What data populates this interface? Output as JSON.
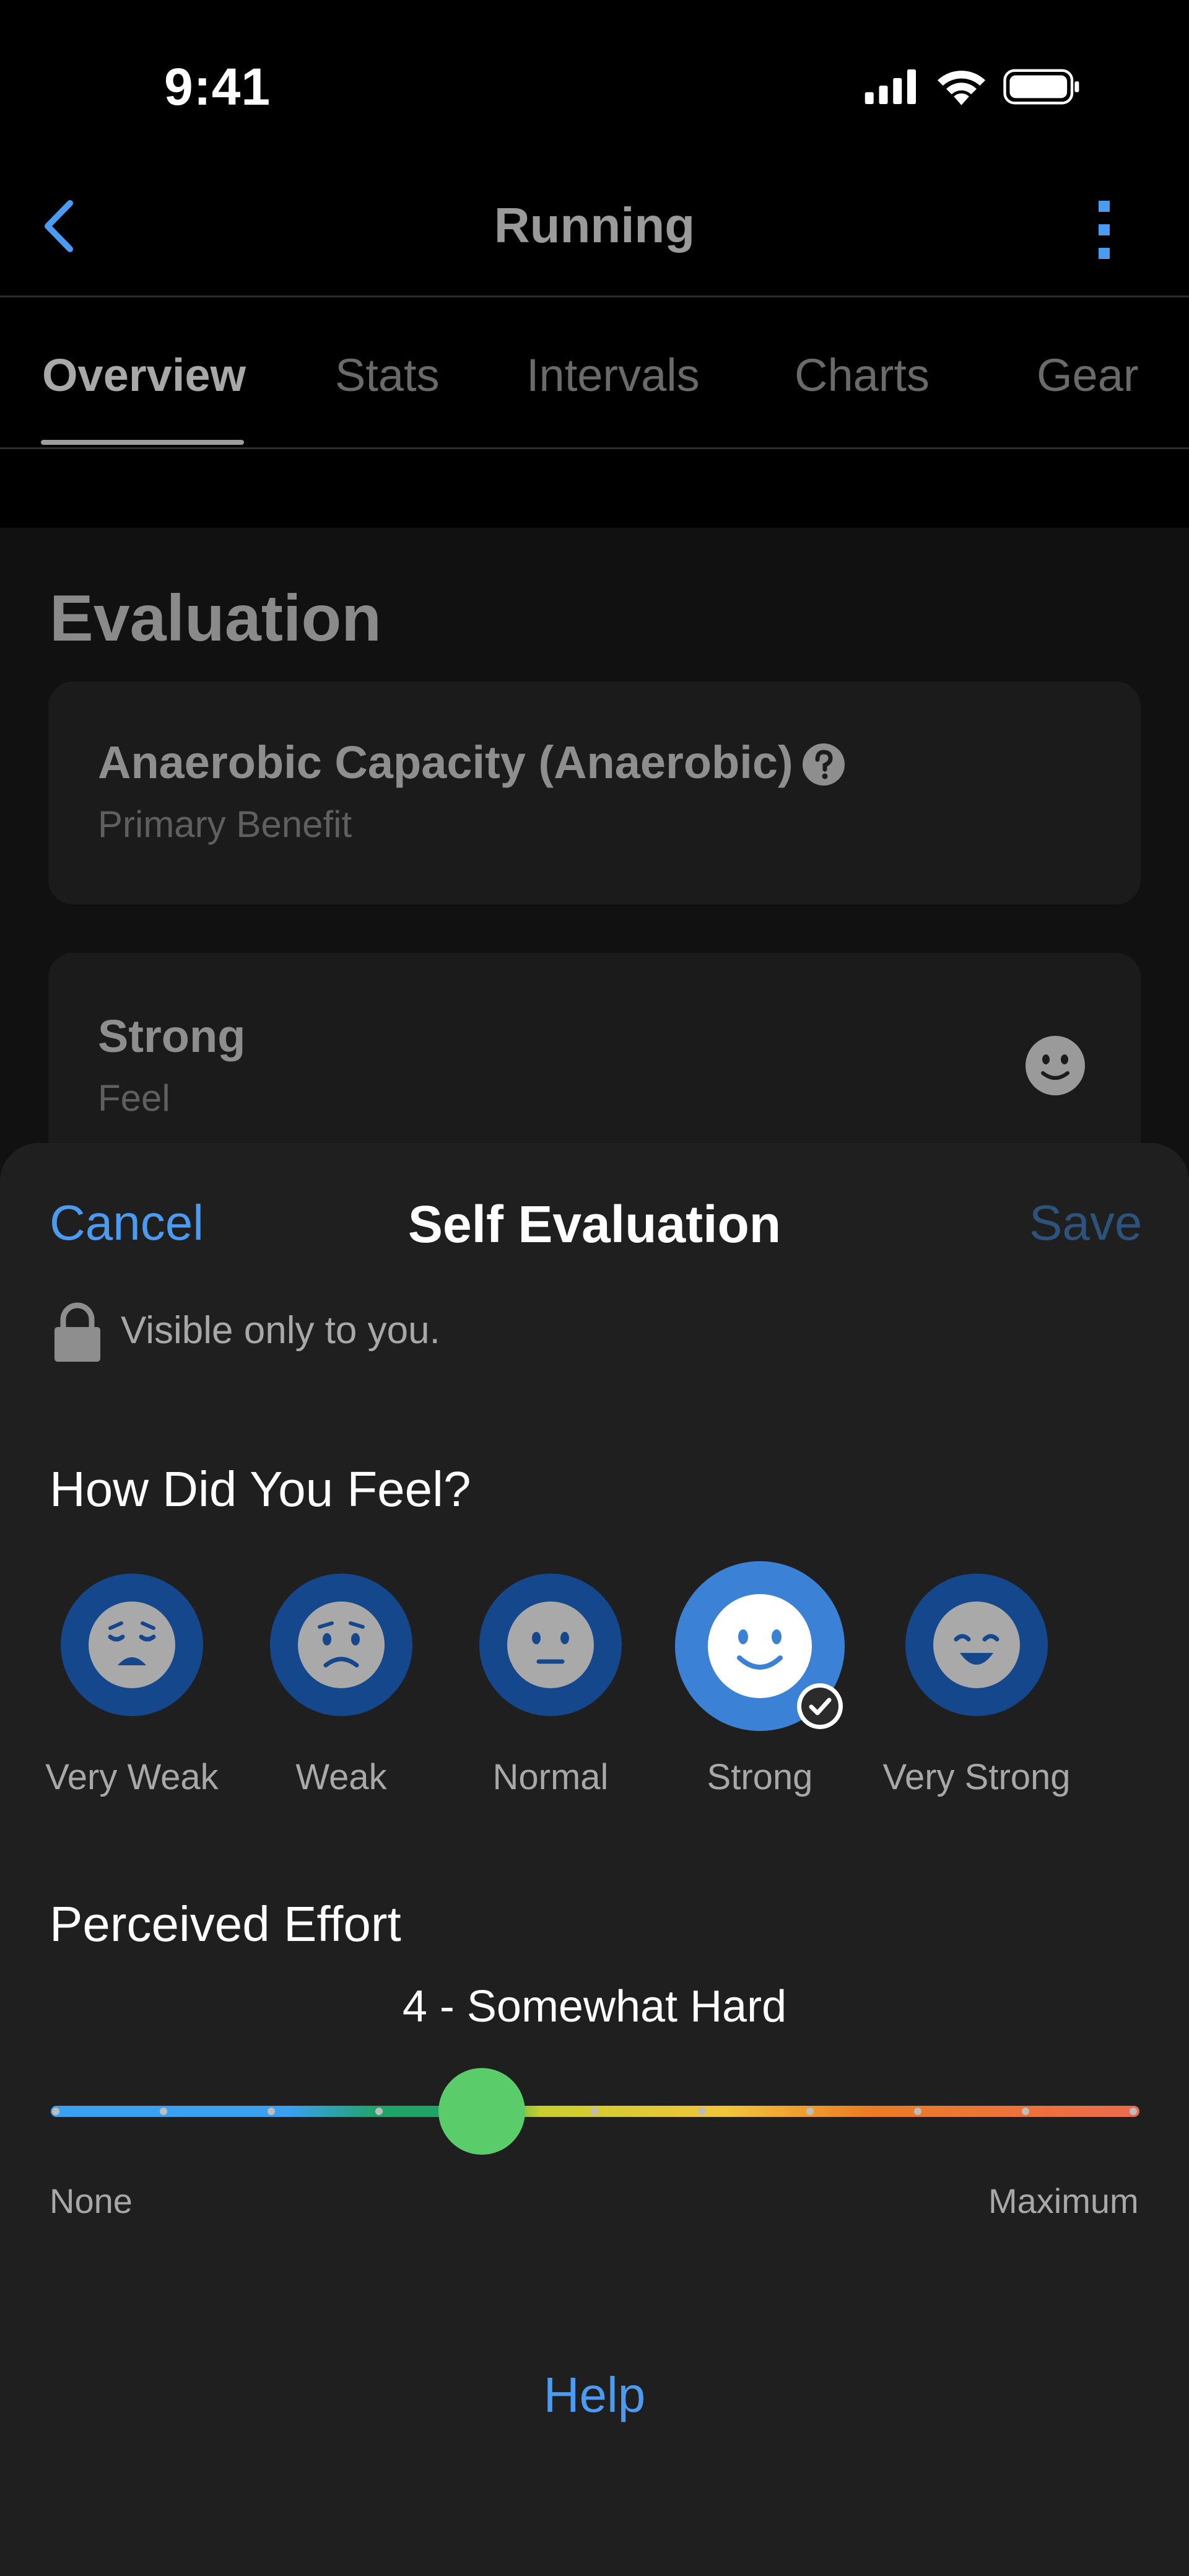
{
  "status_bar": {
    "time": "9:41"
  },
  "nav": {
    "title": "Running"
  },
  "tabs": [
    {
      "label": "Overview",
      "active": true
    },
    {
      "label": "Stats"
    },
    {
      "label": "Intervals"
    },
    {
      "label": "Charts"
    },
    {
      "label": "Gear"
    }
  ],
  "evaluation": {
    "section_title": "Evaluation",
    "benefit": {
      "title": "Anaerobic Capacity (Anaerobic)",
      "subtitle": "Primary Benefit",
      "icon": "question-circle-icon"
    },
    "feel": {
      "title": "Strong",
      "subtitle": "Feel",
      "icon": "smile-face-icon"
    }
  },
  "sheet": {
    "cancel_label": "Cancel",
    "title": "Self Evaluation",
    "save_label": "Save",
    "visibility_text": "Visible only to you.",
    "feel_question": "How Did You Feel?",
    "feel_options": [
      {
        "label": "Very Weak",
        "icon": "very-weak-face-icon"
      },
      {
        "label": "Weak",
        "icon": "weak-face-icon"
      },
      {
        "label": "Normal",
        "icon": "normal-face-icon"
      },
      {
        "label": "Strong",
        "icon": "strong-face-icon",
        "selected": true
      },
      {
        "label": "Very Strong",
        "icon": "very-strong-face-icon"
      }
    ],
    "effort_title": "Perceived Effort",
    "effort_value_label": "4 - Somewhat Hard",
    "effort_value": 4,
    "effort_max": 10,
    "min_label": "None",
    "max_label": "Maximum",
    "help_label": "Help"
  },
  "colors": {
    "accent": "#4a9bf1",
    "selected_face": "#3b82d6",
    "face_bg": "#15478c",
    "thumb": "#5bcc6a"
  }
}
